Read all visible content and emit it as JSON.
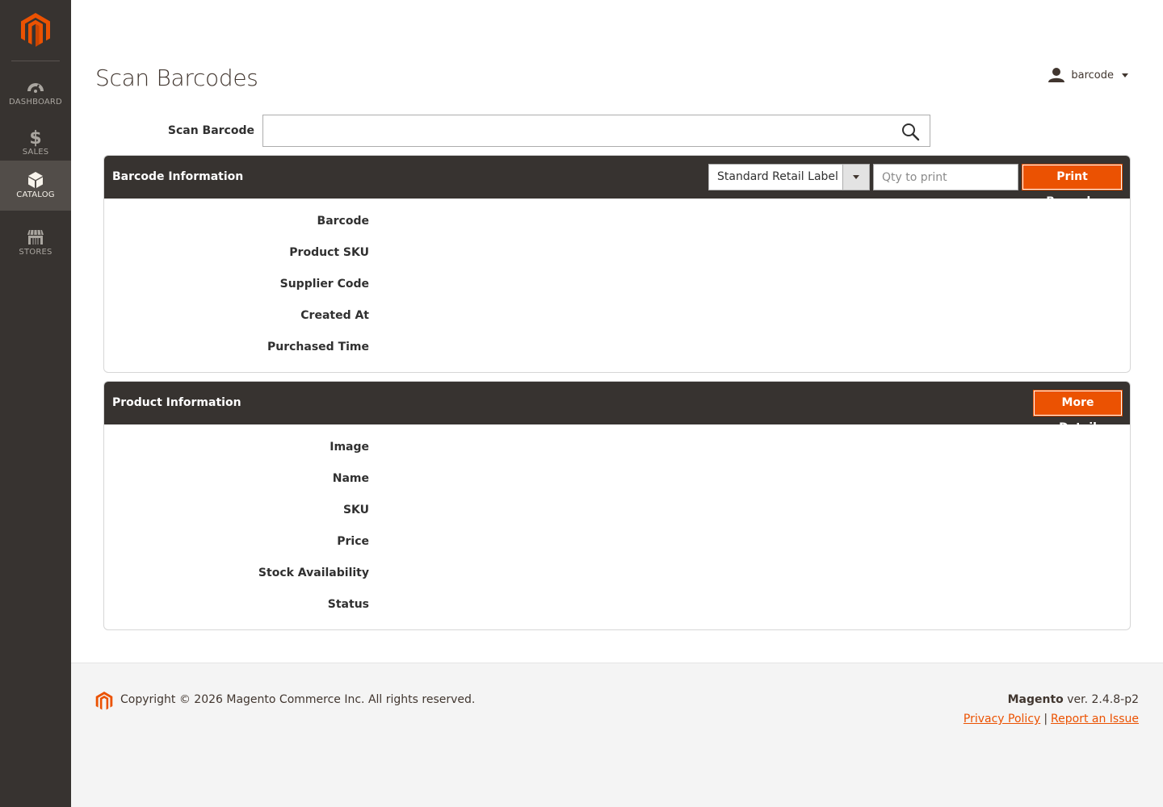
{
  "sidebar": {
    "logo": "magento-logo",
    "items": [
      {
        "label": "DASHBOARD",
        "icon": "dashboard-icon",
        "active": false
      },
      {
        "label": "SALES",
        "icon": "dollar-icon",
        "active": false
      },
      {
        "label": "CATALOG",
        "icon": "box-icon",
        "active": true
      },
      {
        "label": "STORES",
        "icon": "store-icon",
        "active": false
      }
    ]
  },
  "header": {
    "title": "Scan Barcodes",
    "user": "barcode"
  },
  "scan": {
    "label": "Scan Barcode",
    "value": "",
    "placeholder": ""
  },
  "barcode_panel": {
    "title": "Barcode Information",
    "label_type": "Standard Retail Label",
    "qty_placeholder": "Qty to print",
    "print_button": "Print Barcode",
    "fields": [
      "Barcode",
      "Product SKU",
      "Supplier Code",
      "Created At",
      "Purchased Time"
    ]
  },
  "product_panel": {
    "title": "Product Information",
    "more_button": "More Detail",
    "fields": [
      "Image",
      "Name",
      "SKU",
      "Price",
      "Stock Availability",
      "Status"
    ]
  },
  "footer": {
    "copyright": "Copyright © 2026 Magento Commerce Inc. All rights reserved.",
    "brand": "Magento",
    "version": "ver. 2.4.8-p2",
    "privacy": "Privacy Policy",
    "separator": "|",
    "report": "Report an Issue"
  },
  "colors": {
    "sidebar_bg": "#373330",
    "sidebar_active": "#524d49",
    "accent": "#eb5202",
    "panel_header": "#373330"
  }
}
